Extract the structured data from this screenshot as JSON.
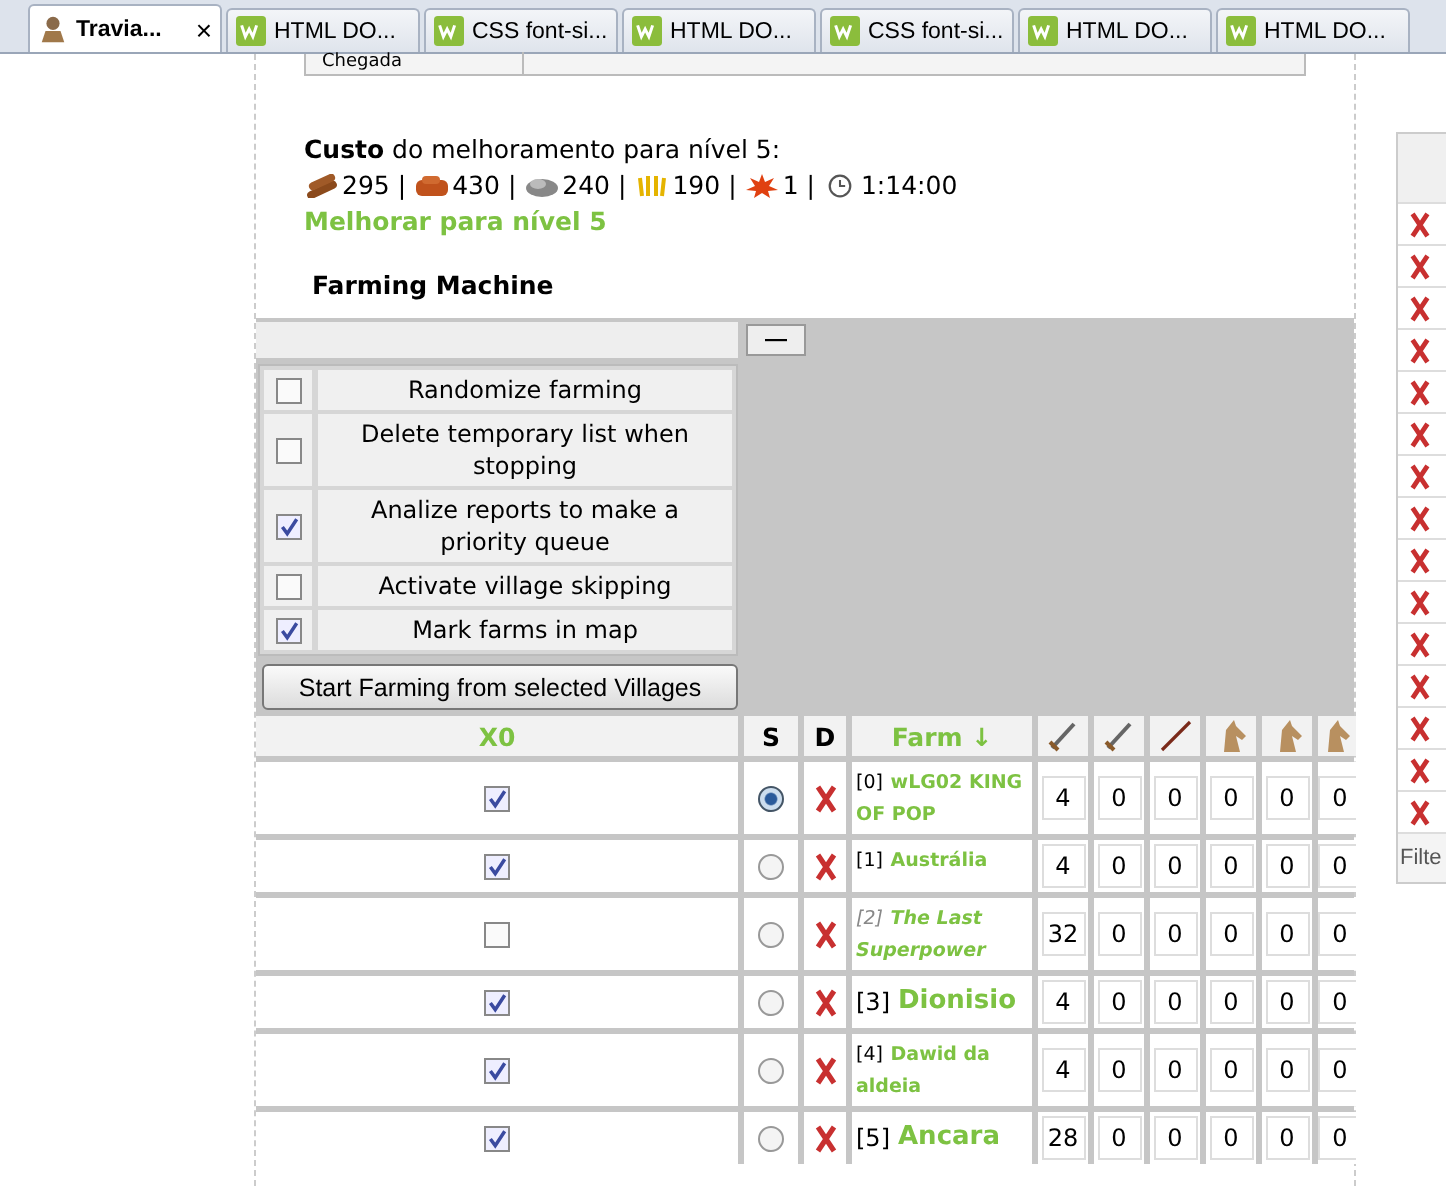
{
  "tabs": [
    {
      "label": "Travia...",
      "selected": true
    },
    {
      "label": "HTML DO...",
      "selected": false
    },
    {
      "label": "CSS font-si...",
      "selected": false
    },
    {
      "label": "HTML DO...",
      "selected": false
    },
    {
      "label": "CSS font-si...",
      "selected": false
    },
    {
      "label": "HTML DO...",
      "selected": false
    },
    {
      "label": "HTML DO...",
      "selected": false
    }
  ],
  "close_glyph": "×",
  "top_table": {
    "cell": "Chegada"
  },
  "cost": {
    "heading": "**Custo** do melhoramento para nível 5:",
    "separator": "|",
    "resources": [
      {
        "kind": "wood",
        "amount": "295"
      },
      {
        "kind": "clay",
        "amount": "430"
      },
      {
        "kind": "iron",
        "amount": "240"
      },
      {
        "kind": "crop",
        "amount": "190"
      },
      {
        "kind": "upkeep",
        "amount": "1"
      },
      {
        "kind": "time",
        "amount": "1:14:00"
      }
    ],
    "upgrade_link": "Melhorar para nível 5"
  },
  "farming_machine": {
    "title": "Farming Machine",
    "collapse_button": "—",
    "options": [
      {
        "label": "Randomize farming",
        "checked": false
      },
      {
        "label": "Delete temporary list when stopping",
        "checked": false
      },
      {
        "label": "Analize reports to make a priority queue",
        "checked": true
      },
      {
        "label": "Activate village skipping",
        "checked": false
      },
      {
        "label": "Mark farms in map",
        "checked": true
      }
    ],
    "start_button": "Start Farming from selected Villages"
  },
  "farm_table": {
    "columns": {
      "village": "X0",
      "s": "S",
      "d": "D",
      "farm": "Farm ↓"
    },
    "rows": [
      {
        "checked": true,
        "selected": true,
        "index": "[0]",
        "name": "wLG02 KING OF POP",
        "kind": "small",
        "units": [
          "4",
          "0",
          "0",
          "0",
          "0",
          "0"
        ]
      },
      {
        "checked": true,
        "selected": false,
        "index": "[1]",
        "name": "Austrália",
        "kind": "small",
        "units": [
          "4",
          "0",
          "0",
          "0",
          "0",
          "0"
        ]
      },
      {
        "checked": false,
        "selected": false,
        "index": "[2]",
        "name": "The Last Superpower",
        "kind": "inactive",
        "units": [
          "32",
          "0",
          "0",
          "0",
          "0",
          "0"
        ]
      },
      {
        "checked": true,
        "selected": false,
        "index": "[3]",
        "name": "Dionisio",
        "kind": "large",
        "units": [
          "4",
          "0",
          "0",
          "0",
          "0",
          "0"
        ]
      },
      {
        "checked": true,
        "selected": false,
        "index": "[4]",
        "name": "Dawid da aldeia",
        "kind": "small",
        "units": [
          "4",
          "0",
          "0",
          "0",
          "0",
          "0"
        ]
      },
      {
        "checked": true,
        "selected": false,
        "index": "[5]",
        "name": "Ancara",
        "kind": "large",
        "units": [
          "28",
          "0",
          "0",
          "0",
          "0",
          "0"
        ]
      }
    ]
  },
  "side_panel": {
    "filter_label": "Filte"
  }
}
